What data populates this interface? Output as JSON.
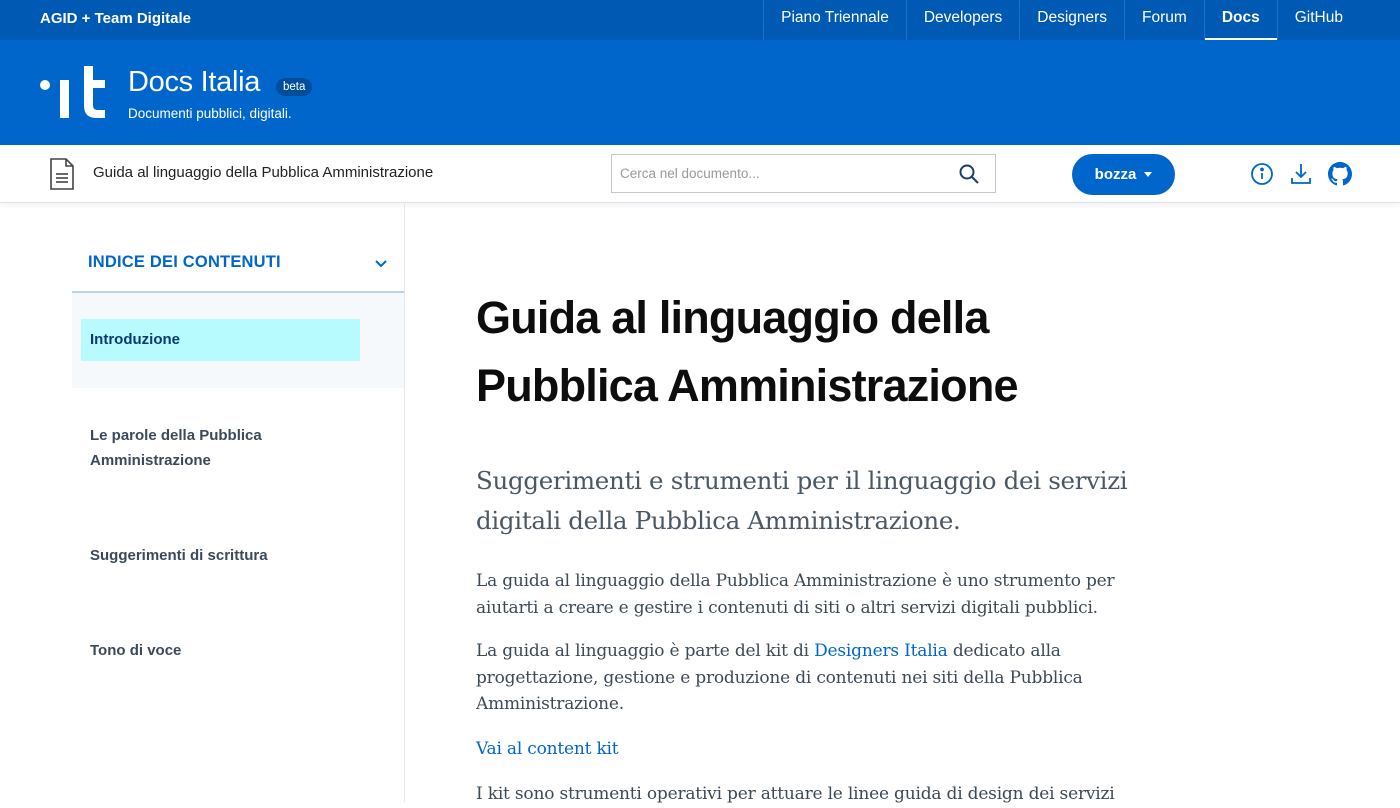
{
  "topbar": {
    "brand": "AGID + Team Digitale",
    "nav": [
      {
        "label": "Piano Triennale",
        "active": false
      },
      {
        "label": "Developers",
        "active": false
      },
      {
        "label": "Designers",
        "active": false
      },
      {
        "label": "Forum",
        "active": false
      },
      {
        "label": "Docs",
        "active": true
      },
      {
        "label": "GitHub",
        "active": false
      }
    ]
  },
  "header": {
    "logo_icon": "dot-it-logo",
    "title": "Docs Italia",
    "badge": "beta",
    "subtitle": "Documenti pubblici, digitali."
  },
  "docbar": {
    "doc_icon": "document-icon",
    "doc_title": "Guida al linguaggio della Pubblica Amministrazione",
    "search_placeholder": "Cerca nel documento...",
    "search_value": "",
    "version_button": "bozza",
    "tools": [
      "info-icon",
      "download-icon",
      "github-icon"
    ]
  },
  "sidebar": {
    "toc_label": "INDICE DEI CONTENUTI",
    "items": [
      {
        "label": "Introduzione",
        "active": true
      },
      {
        "label": "Le parole della Pubblica Amministrazione",
        "active": false
      },
      {
        "label": "Suggerimenti di scrittura",
        "active": false
      },
      {
        "label": "Tono di voce",
        "active": false
      }
    ]
  },
  "main": {
    "title": "Guida al linguaggio della Pubblica Amministrazione",
    "lead": "Suggerimenti e strumenti per il linguaggio dei servizi digitali della Pubblica Amministrazione.",
    "p1": "La guida al linguaggio della Pubblica Amministrazione è uno strumento per aiutarti a creare e gestire i contenuti di siti o altri servizi digitali pubblici.",
    "p2_before": "La guida al linguaggio è parte del kit di ",
    "p2_link": "Designers Italia",
    "p2_after": " dedicato alla progettazione, gestione e produzione di contenuti nei siti della Pubblica Amministrazione.",
    "content_kit_link": "Vai al content kit",
    "p3": "I kit sono strumenti operativi per attuare le linee guida di design dei servizi"
  },
  "colors": {
    "topbar": "#0059b3",
    "header": "#0066cc",
    "accent": "#0066cc",
    "toc_active_bg": "#b8fbff"
  }
}
